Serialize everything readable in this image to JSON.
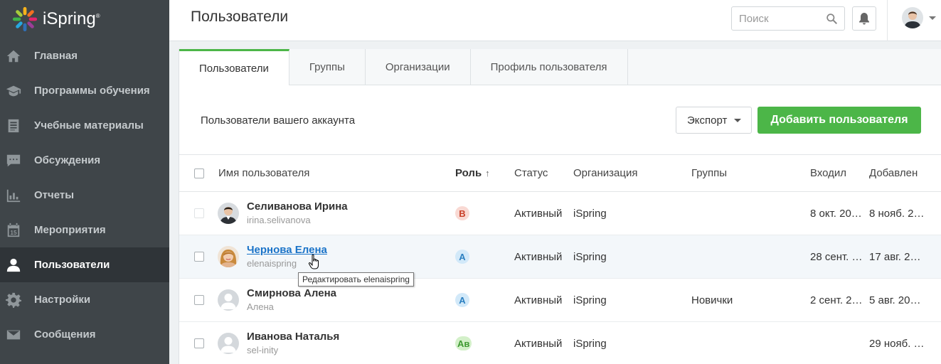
{
  "app": {
    "logo_text": "iSpring",
    "logo_mark": "®"
  },
  "sidebar": {
    "items": [
      {
        "label": "Главная",
        "icon": "home-icon",
        "active": false
      },
      {
        "label": "Программы обучения",
        "icon": "graduation-cap-icon",
        "active": false
      },
      {
        "label": "Учебные материалы",
        "icon": "document-list-icon",
        "active": false
      },
      {
        "label": "Обсуждения",
        "icon": "chat-bubble-icon",
        "active": false
      },
      {
        "label": "Отчеты",
        "icon": "bar-chart-icon",
        "active": false
      },
      {
        "label": "Мероприятия",
        "icon": "calendar-icon",
        "active": false
      },
      {
        "label": "Пользователи",
        "icon": "user-icon",
        "active": true
      },
      {
        "label": "Настройки",
        "icon": "gear-icon",
        "active": false
      },
      {
        "label": "Сообщения",
        "icon": "envelope-icon",
        "active": false
      }
    ],
    "calendar_day": "15"
  },
  "header": {
    "title": "Пользователи",
    "search_placeholder": "Поиск"
  },
  "tabs": [
    {
      "label": "Пользователи",
      "active": true
    },
    {
      "label": "Группы",
      "active": false
    },
    {
      "label": "Организации",
      "active": false
    },
    {
      "label": "Профиль пользователя",
      "active": false
    }
  ],
  "toolbar": {
    "label": "Пользователи вашего аккаунта",
    "export_label": "Экспорт",
    "add_label": "Добавить пользователя"
  },
  "table": {
    "columns": {
      "name": "Имя пользователя",
      "role": "Роль",
      "role_sort": "↑",
      "status": "Статус",
      "org": "Организация",
      "groups": "Группы",
      "login": "Входил",
      "added": "Добавлен"
    },
    "rows": [
      {
        "name": "Селиванова Ирина",
        "login": "irina.selivanova",
        "role": "В",
        "role_bg": "#f9d9d3",
        "role_fg": "#c9412a",
        "status": "Активный",
        "org": "iSpring",
        "groups": "",
        "last_login": "8 окт. 20…",
        "added": "8 нояб. 2…",
        "avatar": "photo-man",
        "checkbox_disabled": true
      },
      {
        "name": "Чернова Елена",
        "login": "elenaispring",
        "role": "А",
        "role_bg": "#d2e9f9",
        "role_fg": "#2b7fc0",
        "status": "Активный",
        "org": "iSpring",
        "groups": "",
        "last_login": "28 сент. …",
        "added": "17 авг. 2…",
        "avatar": "photo-woman",
        "checkbox_disabled": false
      },
      {
        "name": "Смирнова Алена",
        "login": "Алена",
        "role": "А",
        "role_bg": "#d2e9f9",
        "role_fg": "#2b7fc0",
        "status": "Активный",
        "org": "iSpring",
        "groups": "Новички",
        "last_login": "2 сент. 2…",
        "added": "5 авг. 20…",
        "avatar": "placeholder",
        "checkbox_disabled": false
      },
      {
        "name": "Иванова Наталья",
        "login": "sel-inity",
        "role": "Ав",
        "role_bg": "#d3f0c9",
        "role_fg": "#3f9a32",
        "status": "Активный",
        "org": "iSpring",
        "groups": "",
        "last_login": "",
        "added": "29 нояб. …",
        "avatar": "placeholder",
        "checkbox_disabled": false
      }
    ]
  },
  "tooltip": {
    "text": "Редактировать elenaispring"
  },
  "colors": {
    "sidebar_bg": "#3f4549",
    "sidebar_active": "#2f3438",
    "accent_green": "#4cb648",
    "link_blue": "#1a73c8"
  }
}
